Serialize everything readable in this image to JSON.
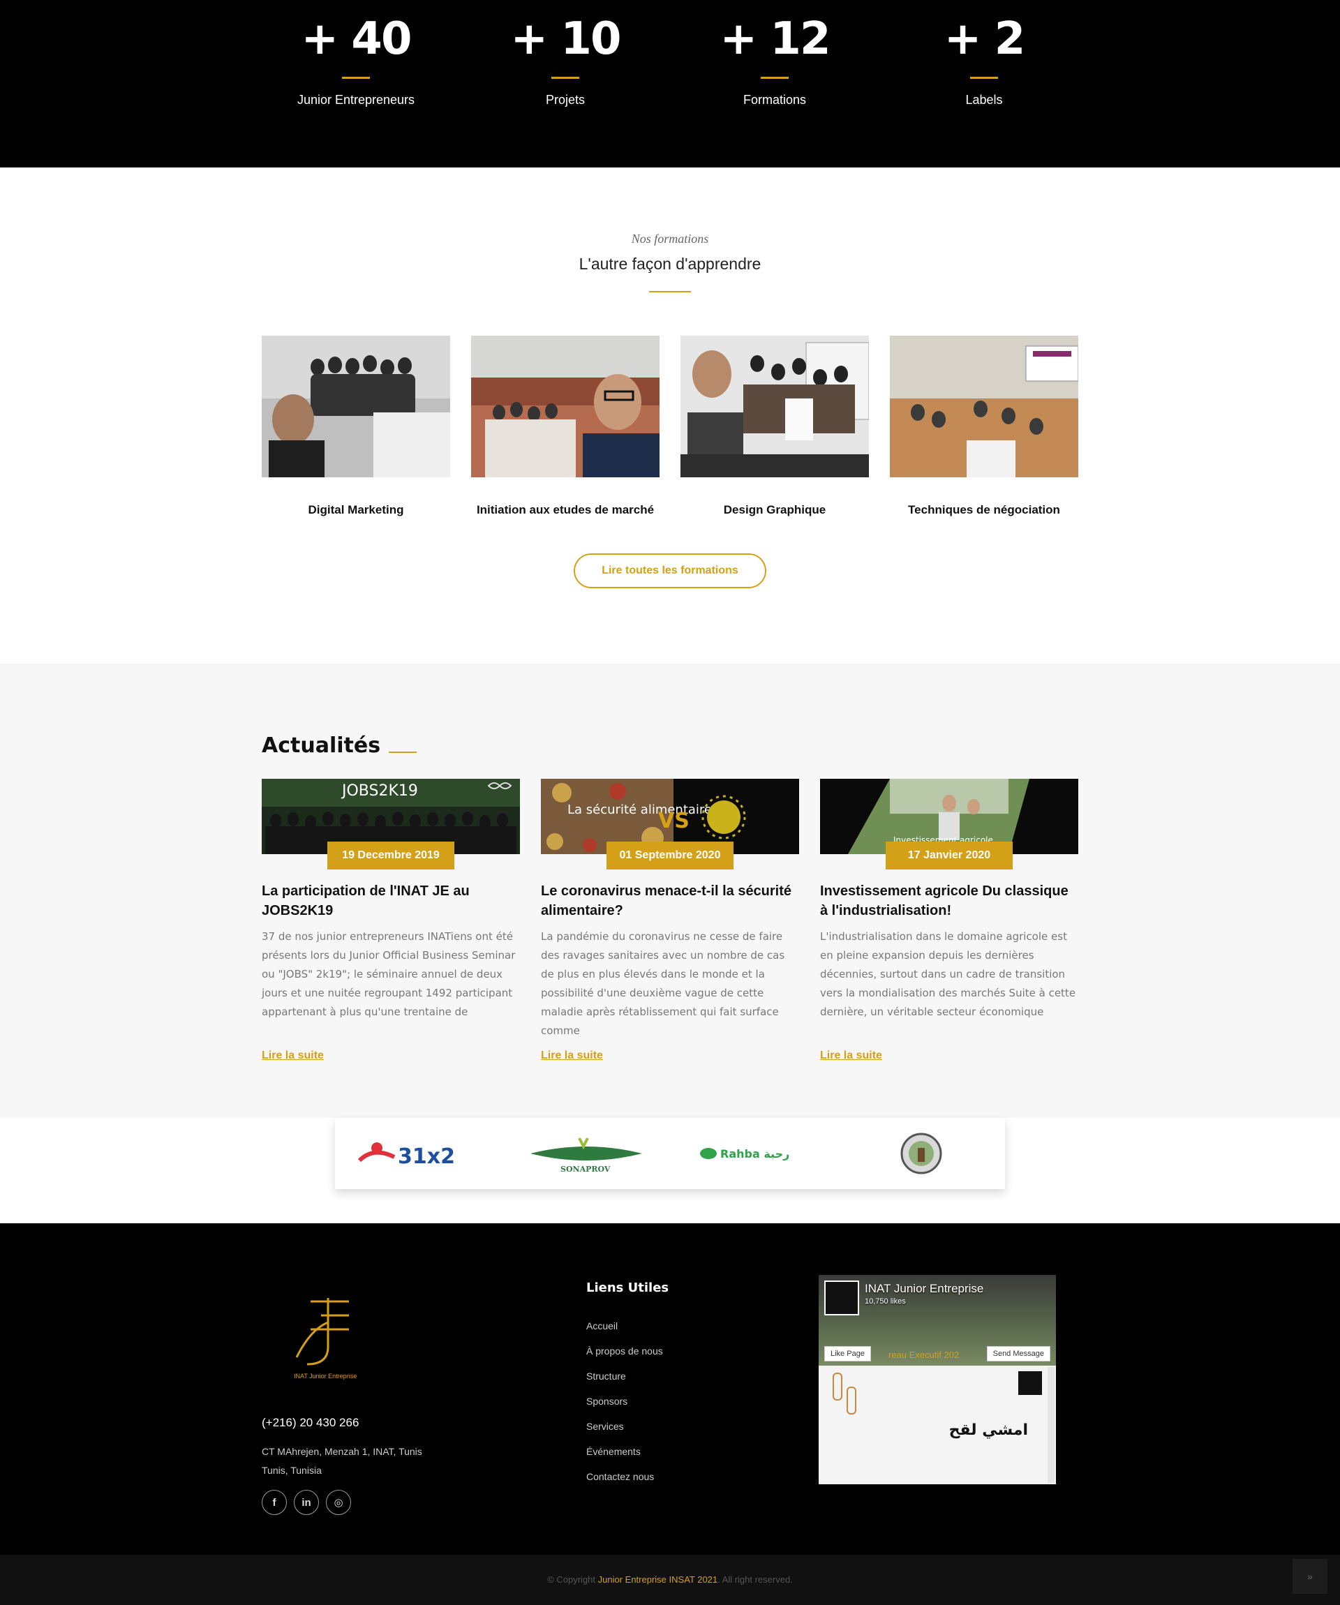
{
  "stats": [
    {
      "number": "+ 40",
      "label": "Junior Entrepreneurs"
    },
    {
      "number": "+ 10",
      "label": "Projets"
    },
    {
      "number": "+ 12",
      "label": "Formations"
    },
    {
      "number": "+ 2",
      "label": "Labels"
    }
  ],
  "formations": {
    "subtitle": "Nos formations",
    "title": "L'autre façon d'apprendre",
    "cards": [
      {
        "title": "Digital Marketing"
      },
      {
        "title": "Initiation aux etudes de marché"
      },
      {
        "title": "Design Graphique"
      },
      {
        "title": "Techniques de négociation"
      }
    ],
    "button": "Lire toutes les formations"
  },
  "news": {
    "heading": "Actualités",
    "items": [
      {
        "image_caption": "JOBS2K19",
        "date": "19 Decembre 2019",
        "title": "La participation de l'INAT JE au JOBS2K19",
        "excerpt": "37 de nos junior entrepreneurs INATiens ont été présents lors du Junior Official Business Seminar ou \"JOBS\" 2k19\"; le séminaire annuel de deux jours et une nuitée regroupant 1492 participant appartenant à plus qu'une trentaine de",
        "link": "Lire la suite"
      },
      {
        "image_caption": "La sécurité alimentaire",
        "image_caption_2": "VS",
        "date": "01 Septembre 2020",
        "title": "Le coronavirus menace-t-il la sécurité alimentaire?",
        "excerpt": "La pandémie du coronavirus ne cesse de faire des ravages sanitaires avec un nombre de cas de plus en plus élevés dans le monde et la possibilité d'une deuxième vague de cette maladie après rétablissement qui fait surface comme",
        "link": "Lire la suite"
      },
      {
        "image_caption": "Investissement agricole",
        "date": "17 Janvier 2020",
        "title": "Investissement agricole Du classique à l'industrialisation!",
        "excerpt": "L'industrialisation dans le domaine agricole est en pleine expansion depuis les dernières décennies, surtout dans un cadre de transition vers la mondialisation des marchés Suite à cette dernière, un véritable secteur économique",
        "link": "Lire la suite"
      }
    ]
  },
  "partners": [
    {
      "name": "31x2"
    },
    {
      "name": "SONAPROV"
    },
    {
      "name": "Rahba رحبة"
    },
    {
      "name": "seal-logo"
    }
  ],
  "footer": {
    "logo_text": "INAT Junior Entreprise",
    "phone": "(+216) 20 430 266",
    "address_line1": "CT MAhrejen, Menzah 1, INAT, Tunis",
    "address_line2": "Tunis, Tunisia",
    "socials": [
      "f",
      "in",
      "◎"
    ],
    "links_heading": "Liens Utiles",
    "links": [
      "Accueil",
      "À propos de nous",
      "Structure",
      "Sponsors",
      "Services",
      "Événements",
      "Contactez nous"
    ],
    "facebook": {
      "page_name": "INAT Junior Entreprise",
      "likes": "10,750 likes",
      "like_button": "Like Page",
      "message_button": "Send Message",
      "cover_text": "reau Executif 202",
      "post_text": "امشي لقح"
    }
  },
  "copyright": {
    "prefix": "© Copyright",
    "brand": "Junior Entreprise INSAT 2021",
    "suffix": ". All right reserved."
  },
  "colors": {
    "accent": "#d4a017",
    "dark": "#000000"
  }
}
